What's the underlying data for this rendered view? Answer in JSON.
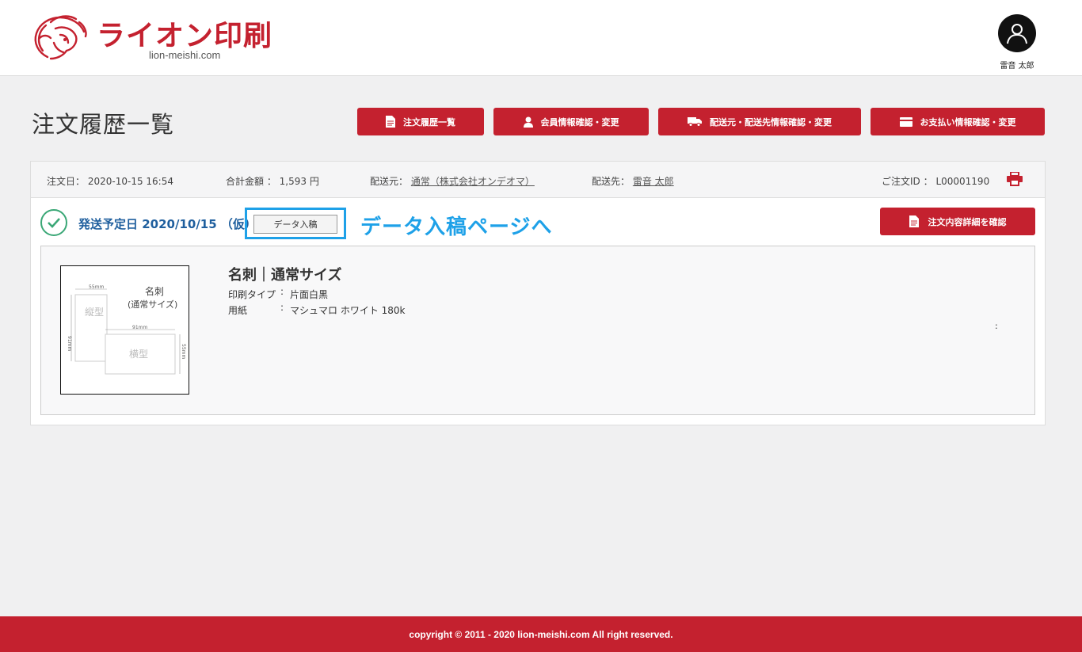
{
  "header": {
    "logo_text": "ライオン印刷",
    "logo_sub": "lion-meishi.com",
    "user_name": "雷音 太郎"
  },
  "page": {
    "title": "注文履歴一覧"
  },
  "nav": {
    "order_history": "注文履歴一覧",
    "member_info": "会員情報確認・変更",
    "shipping_info": "配送元・配送先情報確認・変更",
    "payment_info": "お支払い情報確認・変更"
  },
  "order": {
    "date_label": "注文日：",
    "date_value": "2020-10-15 16:54",
    "total_label": "合計金額 ：",
    "total_value": "1,593 円",
    "from_label": "配送元：",
    "from_value": "通常（株式会社オンデオマ）",
    "to_label": "配送先：",
    "to_value": "雷音 太郎",
    "id_label": "ご注文ID ：",
    "id_value": "L00001190",
    "ship_date": "発送予定日 2020/10/15 （仮）",
    "upload_button": "データ入稿",
    "annotation": "データ入稿ページへ",
    "detail_button": "注文内容詳細を確認"
  },
  "item": {
    "name": "名刺｜通常サイズ",
    "print_type_label": "印刷タイプ",
    "print_type_value": "片面白黒",
    "paper_label": "用紙",
    "paper_value": "マシュマロ ホワイト 180k",
    "stray_colon": ":",
    "thumb": {
      "title": "名刺",
      "subtitle": "(通常サイズ)",
      "vertical": "縦型",
      "horizontal": "横型",
      "dim_55": "55mm",
      "dim_91": "91mm"
    }
  },
  "footer": {
    "copyright": "copyright © 2011 - 2020 lion-meishi.com All right reserved."
  },
  "colors": {
    "brand_red": "#c4212f",
    "link_blue": "#1f5f9e",
    "annotation_blue": "#1ea1e8",
    "check_green": "#3aa776"
  }
}
